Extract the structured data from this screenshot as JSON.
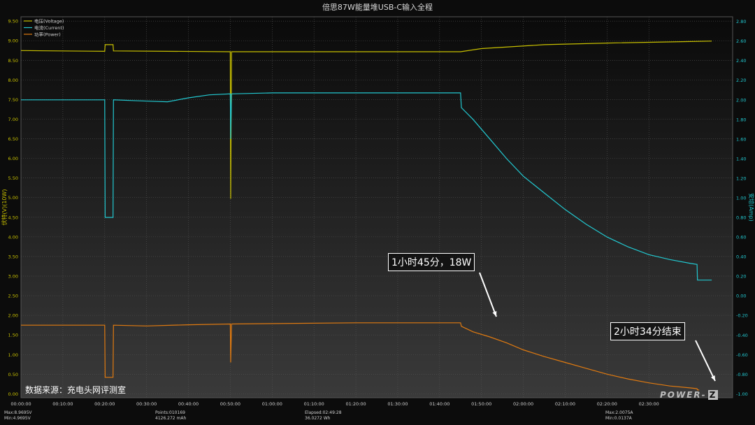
{
  "title": "倍思87W能量堆USB-C输入全程",
  "source_note": "数据来源：充电头网评测室",
  "watermark": {
    "text": "POWER-",
    "mark": "Z"
  },
  "callouts": [
    {
      "text": "1小时45分，18W"
    },
    {
      "text": "2小时34分结束"
    }
  ],
  "footer": {
    "max_voltage": "Max:8.9695V",
    "min_voltage": "Min:4.9695V",
    "points": "Points:010169",
    "capacity": "4126.272 mAh",
    "elapsed": "Elapsed:02:49:28",
    "energy": "36.0272 Wh",
    "max_current": "Max:2.0075A",
    "min_current": "Min:0.0137A"
  },
  "chart_data": {
    "type": "line",
    "title": "倍思87W能量堆USB-C输入全程",
    "ylabel_left": "伏特(V)(10W)",
    "ylabel_right": "安培(Amp)",
    "ylim_left": [
      0,
      9.5
    ],
    "ylim_right": [
      -1.0,
      2.8
    ],
    "xlim_minutes": [
      0,
      170
    ],
    "grid": true,
    "legend_position": "top-left",
    "x_ticks": [
      "00:00:00",
      "00:10:00",
      "00:20:00",
      "00:30:00",
      "00:40:00",
      "00:50:00",
      "01:00:00",
      "01:10:00",
      "01:20:00",
      "01:30:00",
      "01:40:00",
      "01:50:00",
      "02:00:00",
      "02:10:00",
      "02:20:00",
      "02:30:00"
    ],
    "y_left_ticks": [
      "0.00",
      "0.50",
      "1.00",
      "1.50",
      "2.00",
      "2.50",
      "3.00",
      "3.50",
      "4.00",
      "4.50",
      "5.00",
      "5.50",
      "6.00",
      "6.50",
      "7.00",
      "7.50",
      "8.00",
      "8.50",
      "9.00",
      "9.50"
    ],
    "y_right_ticks": [
      "-1.00",
      "-0.80",
      "-0.60",
      "-0.40",
      "-0.20",
      "0.00",
      "0.20",
      "0.40",
      "0.60",
      "0.80",
      "1.00",
      "1.20",
      "1.40",
      "1.60",
      "1.80",
      "2.00",
      "2.20",
      "2.40",
      "2.60",
      "2.80"
    ],
    "series": [
      {
        "name": "电压(Voltage)",
        "axis": "left",
        "color": "#c8c000",
        "points": [
          [
            0,
            8.75
          ],
          [
            9,
            8.74
          ],
          [
            20,
            8.73
          ],
          [
            20.1,
            8.9
          ],
          [
            22,
            8.9
          ],
          [
            22.1,
            8.74
          ],
          [
            50,
            8.72
          ],
          [
            50.1,
            4.97
          ],
          [
            50.3,
            8.72
          ],
          [
            105,
            8.72
          ],
          [
            110,
            8.8
          ],
          [
            125,
            8.9
          ],
          [
            140,
            8.94
          ],
          [
            160,
            8.98
          ],
          [
            165,
            8.99
          ]
        ]
      },
      {
        "name": "电流(Current)",
        "axis": "right",
        "color": "#22c8d0",
        "points": [
          [
            0,
            2.0
          ],
          [
            20,
            2.0
          ],
          [
            20.1,
            0.8
          ],
          [
            22,
            0.8
          ],
          [
            22.1,
            2.0
          ],
          [
            28,
            1.99
          ],
          [
            35,
            1.98
          ],
          [
            40,
            2.02
          ],
          [
            45,
            2.05
          ],
          [
            50,
            2.06
          ],
          [
            50.1,
            1.6
          ],
          [
            50.3,
            2.06
          ],
          [
            60,
            2.07
          ],
          [
            80,
            2.07
          ],
          [
            105,
            2.07
          ],
          [
            105.2,
            1.92
          ],
          [
            108,
            1.8
          ],
          [
            112,
            1.6
          ],
          [
            116,
            1.4
          ],
          [
            120,
            1.22
          ],
          [
            125,
            1.05
          ],
          [
            130,
            0.88
          ],
          [
            135,
            0.73
          ],
          [
            140,
            0.6
          ],
          [
            145,
            0.5
          ],
          [
            150,
            0.42
          ],
          [
            155,
            0.37
          ],
          [
            160,
            0.33
          ],
          [
            161.5,
            0.32
          ],
          [
            161.6,
            0.16
          ],
          [
            165,
            0.16
          ]
        ]
      },
      {
        "name": "功率(Power)",
        "axis": "left",
        "color": "#e07a10",
        "points": [
          [
            0,
            1.75
          ],
          [
            20,
            1.75
          ],
          [
            20.1,
            0.42
          ],
          [
            22,
            0.42
          ],
          [
            22.1,
            1.75
          ],
          [
            30,
            1.73
          ],
          [
            40,
            1.76
          ],
          [
            50,
            1.78
          ],
          [
            50.1,
            0.8
          ],
          [
            50.3,
            1.78
          ],
          [
            80,
            1.81
          ],
          [
            105,
            1.81
          ],
          [
            105.2,
            1.72
          ],
          [
            108,
            1.58
          ],
          [
            112,
            1.45
          ],
          [
            116,
            1.3
          ],
          [
            120,
            1.12
          ],
          [
            125,
            0.95
          ],
          [
            130,
            0.8
          ],
          [
            135,
            0.65
          ],
          [
            140,
            0.5
          ],
          [
            145,
            0.38
          ],
          [
            150,
            0.28
          ],
          [
            155,
            0.2
          ],
          [
            160,
            0.15
          ],
          [
            161.5,
            0.13
          ],
          [
            161.6,
            0.1
          ],
          [
            162,
            0.1
          ]
        ]
      }
    ]
  }
}
